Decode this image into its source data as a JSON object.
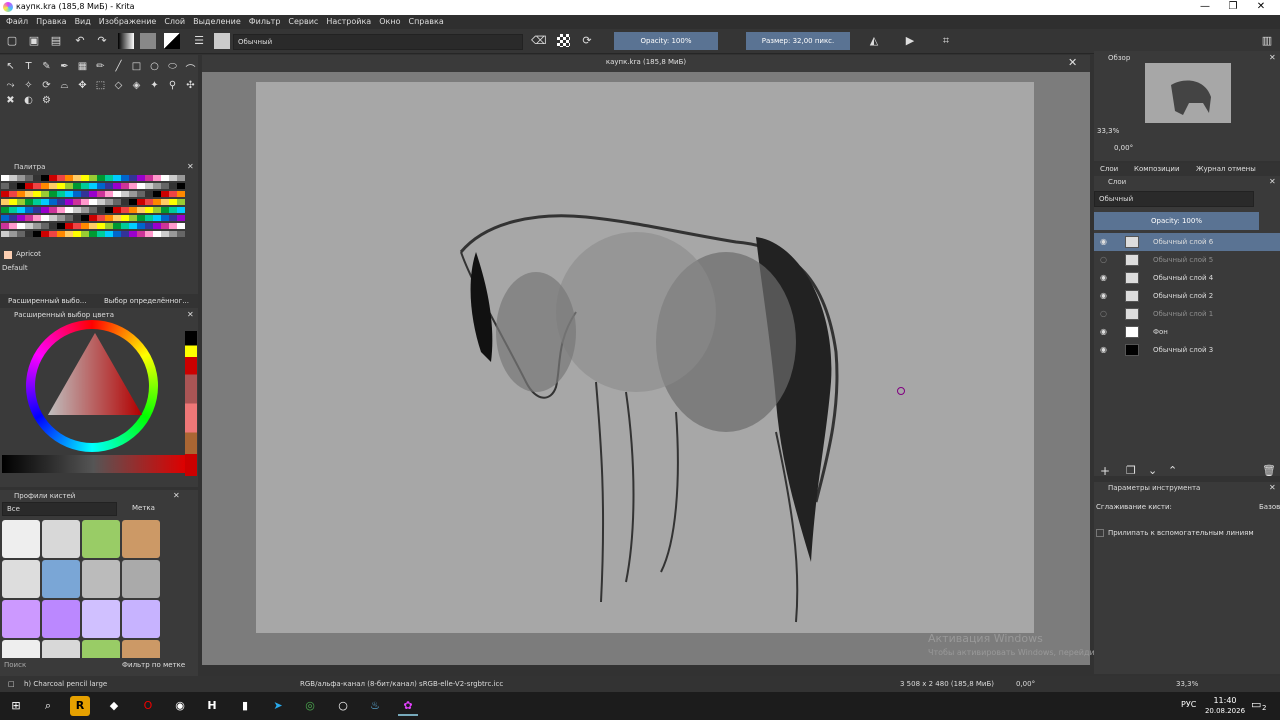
{
  "window": {
    "title": "каупк.kra (185,8 МиБ) - Krita"
  },
  "menu": [
    "Файл",
    "Правка",
    "Вид",
    "Изображение",
    "Слой",
    "Выделение",
    "Фильтр",
    "Сервис",
    "Настройка",
    "Окно",
    "Справка"
  ],
  "toolbar": {
    "blend_mode": "Обычный",
    "opacity": "Opacity: 100%",
    "size": "Размер: 32,00 пикс."
  },
  "palette": {
    "title": "Палитра",
    "selected_color": "Apricot",
    "set": "Default"
  },
  "tabs_left": [
    "Расширенный выбо...",
    "Выбор определённог..."
  ],
  "color_selector": {
    "title": "Расширенный выбор цвета"
  },
  "brush_presets": {
    "title": "Профили кистей",
    "filter": "Все",
    "tag": "Метка",
    "search": "Поиск",
    "filter_by_tag": "Фильтр по метке"
  },
  "document": {
    "tab_title": "каупк.kra (185,8 МиБ)"
  },
  "overview": {
    "title": "Обзор",
    "zoom": "33,3%",
    "rotation": "0,00°"
  },
  "right_tabs": [
    "Слои",
    "Композиции",
    "Журнал отмены"
  ],
  "layers": {
    "title": "Слои",
    "blend_mode": "Обычный",
    "opacity": "Opacity: 100%",
    "items": [
      {
        "name": "Обычный слой 6",
        "selected": true,
        "visible": true
      },
      {
        "name": "Обычный слой 5",
        "selected": false,
        "visible": false
      },
      {
        "name": "Обычный слой 4",
        "selected": false,
        "visible": true
      },
      {
        "name": "Обычный слой 2",
        "selected": false,
        "visible": true
      },
      {
        "name": "Обычный слой 1",
        "selected": false,
        "visible": false
      },
      {
        "name": "Фон",
        "selected": false,
        "visible": true
      },
      {
        "name": "Обычный слой 3",
        "selected": false,
        "visible": true
      }
    ]
  },
  "tool_options": {
    "title": "Параметры инструмента",
    "smoothing": "Сглаживание кисти:",
    "smoothing_value": "Базов",
    "snap": "Прилипать к вспомогательным линиям"
  },
  "watermark": {
    "line1": "Активация Windows",
    "line2": "Чтобы активировать Windows, перейдите в раздел \"Параметры\"."
  },
  "status": {
    "brush": "h) Charcoal pencil large",
    "color_model": "RGB/альфа-канал (8-бит/канал)  sRGB-elle-V2-srgbtrc.icc",
    "dims": "3 508 x 2 480 (185,8 МиБ)",
    "rotation": "0,00°",
    "zoom": "33,3%"
  },
  "taskbar": {
    "lang": "РУС",
    "time": "11:40",
    "date": "20.08.2026",
    "notif": "2"
  }
}
